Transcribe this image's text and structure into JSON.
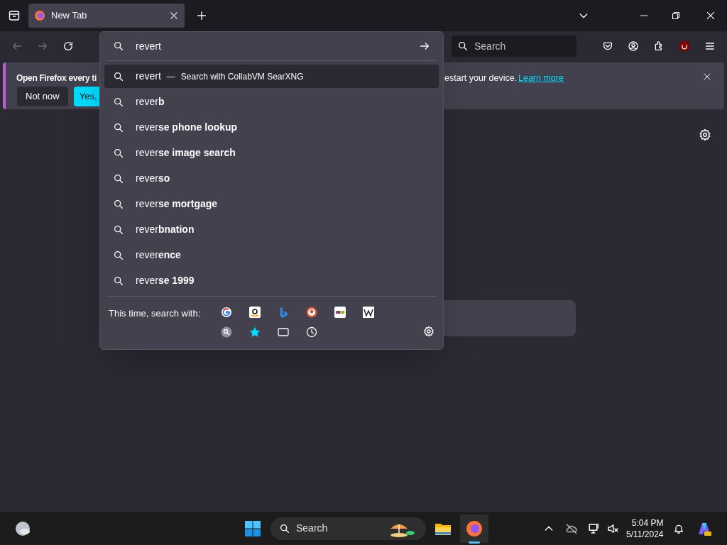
{
  "tabs": [
    {
      "title": "New Tab",
      "selected": true
    }
  ],
  "toolbar": {
    "search_placeholder": "Search"
  },
  "notification": {
    "text_start": "Open Firefox every ti",
    "text_end": "estart your device.",
    "link": "Learn more",
    "buttons": [
      {
        "label": "Not now",
        "kind": "secondary"
      },
      {
        "label": "Yes,",
        "kind": "primary"
      }
    ]
  },
  "urlbar": {
    "value": "revert",
    "suggestions": [
      {
        "text": "revert",
        "separator": "—",
        "engine_note": "Search with CollabVM SearXNG",
        "selected": true
      },
      {
        "text": "rever**b**",
        "selected": false
      },
      {
        "text": "rever**se phone lookup**",
        "selected": false
      },
      {
        "text": "rever**se image search**",
        "selected": false
      },
      {
        "text": "rever**so**",
        "selected": false
      },
      {
        "text": "rever**se mortgage**",
        "selected": false
      },
      {
        "text": "rever**bnation**",
        "selected": false
      },
      {
        "text": "rever**ence**",
        "selected": false
      },
      {
        "text": "rever**se 1999**",
        "selected": false
      }
    ],
    "one_off_label": "This time, search with:"
  },
  "taskbar": {
    "search_placeholder": "Search",
    "time": "5:04 PM",
    "date": "5/11/2024"
  }
}
